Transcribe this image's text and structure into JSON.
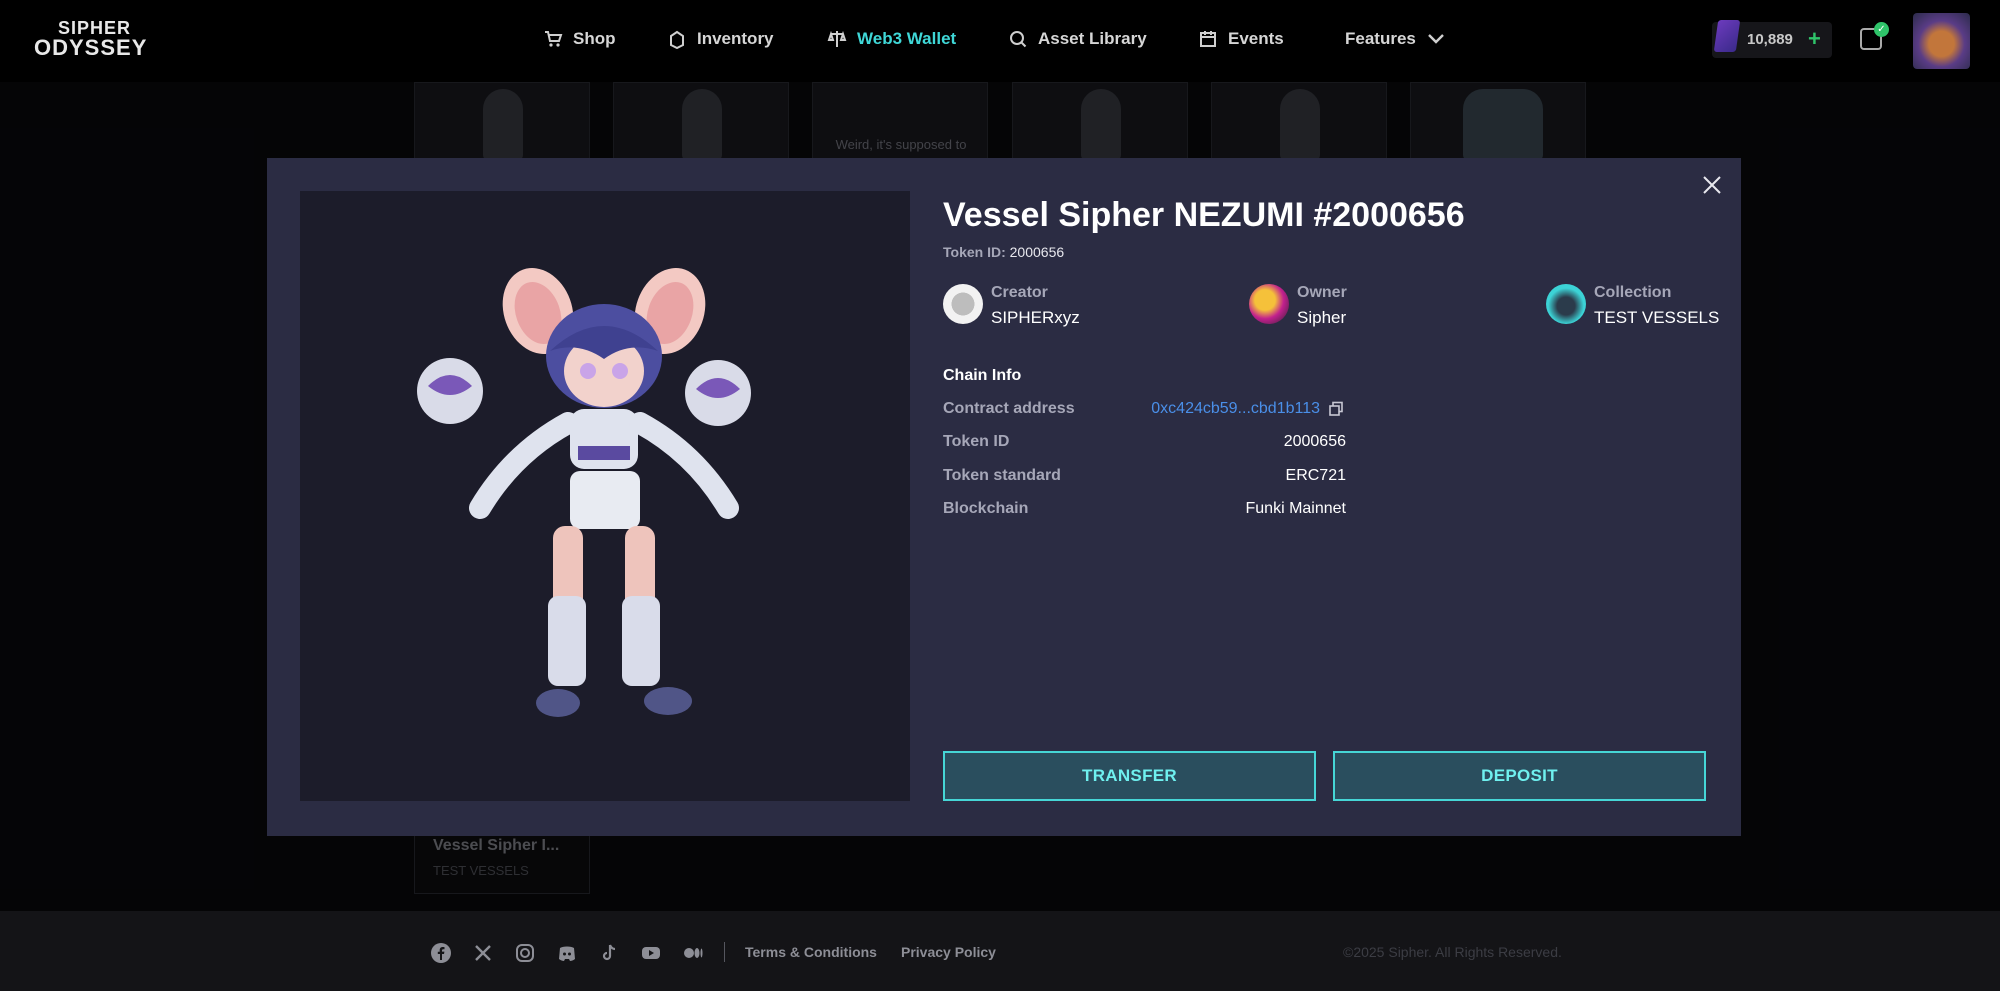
{
  "brand": {
    "line1": "SIPHER",
    "line2": "ODYSSEY"
  },
  "nav": [
    {
      "label": "Shop",
      "icon": "cart-icon",
      "active": false
    },
    {
      "label": "Inventory",
      "icon": "inventory-icon",
      "active": false
    },
    {
      "label": "Web3 Wallet",
      "icon": "scale-icon",
      "active": true
    },
    {
      "label": "Asset Library",
      "icon": "search-icon",
      "active": false
    },
    {
      "label": "Events",
      "icon": "calendar-icon",
      "active": false
    },
    {
      "label": "Features",
      "icon": "chevron-down-icon",
      "active": false
    }
  ],
  "account": {
    "balance": "10,889",
    "plus": "+",
    "cart_badge": "✓"
  },
  "background": {
    "placeholder_text": "Weird, it's supposed to",
    "card_title": "Vessel Sipher I...",
    "card_collection": "TEST VESSELS"
  },
  "modal": {
    "title": "Vessel Sipher NEZUMI #2000656",
    "token_id_label": "Token ID:",
    "token_id_value": "2000656",
    "creator": {
      "label": "Creator",
      "value": "SIPHERxyz"
    },
    "owner": {
      "label": "Owner",
      "value": "Sipher"
    },
    "collection": {
      "label": "Collection",
      "value": "TEST VESSELS"
    },
    "chain_info": {
      "heading": "Chain Info",
      "rows": [
        {
          "label": "Contract address",
          "value": "0xc424cb59...cbd1b113"
        },
        {
          "label": "Token ID",
          "value": "2000656"
        },
        {
          "label": "Token standard",
          "value": "ERC721"
        },
        {
          "label": "Blockchain",
          "value": "Funki Mainnet"
        }
      ]
    },
    "actions": {
      "transfer": "TRANSFER",
      "deposit": "DEPOSIT"
    }
  },
  "footer": {
    "socials": [
      "facebook-icon",
      "x-icon",
      "instagram-icon",
      "discord-icon",
      "tiktok-icon",
      "youtube-icon",
      "medium-icon"
    ],
    "links": [
      "Terms & Conditions",
      "Privacy Policy"
    ],
    "copyright": "©2025 Sipher. All Rights Reserved."
  },
  "colors": {
    "accent": "#3fd7d7",
    "modal_bg": "#2b2c43",
    "link": "#4a8fe8",
    "button_bg": "#2a4e5e"
  }
}
